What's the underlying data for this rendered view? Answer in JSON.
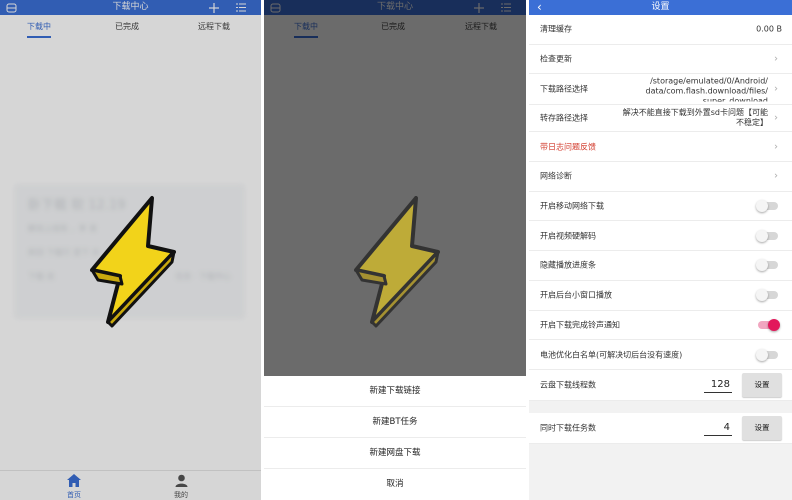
{
  "panel1": {
    "title": "下载中心",
    "tabs": [
      "下载中",
      "已完成",
      "远程下载"
    ],
    "card_title": " 卧下载 软 12.19",
    "card_lines": [
      "解说上线有 ，享 发",
      "新旧 下载行 里下 合"
    ],
    "card_footer_left": "下载 说",
    "card_footer_right": "任务 · 下载中心",
    "bottom_nav": [
      {
        "label": "首页",
        "icon": "home-icon"
      },
      {
        "label": "我的",
        "icon": "user-icon"
      }
    ]
  },
  "panel2": {
    "title": "下载中心",
    "tabs": [
      "下载中",
      "已完成",
      "远程下载"
    ],
    "sheet_items": [
      "新建下载链接",
      "新建BT任务",
      "新建网盘下载",
      "取消"
    ]
  },
  "panel3": {
    "title": "设置",
    "rows": [
      {
        "label": "清理缓存",
        "value": "0.00 B"
      },
      {
        "label": "检查更新"
      },
      {
        "label": "下载路径选择",
        "value_lines": [
          "/storage/emulated/0/Android/",
          "data/com.flash.download/files/",
          "super_download"
        ]
      },
      {
        "label": "转存路径选择",
        "value_lines": [
          "解决不能直接下载到外置sd卡问题【可能",
          "不稳定】"
        ]
      },
      {
        "label": "带日志问题反馈"
      },
      {
        "label": "网络诊断"
      }
    ],
    "toggles": [
      {
        "label": "开启移动网络下载",
        "on": false
      },
      {
        "label": "开启视频硬解码",
        "on": false
      },
      {
        "label": "隐藏播放进度条",
        "on": false
      },
      {
        "label": "开启后台小窗口播放",
        "on": false
      },
      {
        "label": "开启下载完成铃声通知",
        "on": true
      },
      {
        "label": "电池优化白名单(可解决切后台没有速度)",
        "on": false
      }
    ],
    "number_rows": [
      {
        "label": "云盘下载线程数",
        "value": "128",
        "button": "设置"
      },
      {
        "label": "同时下载任务数",
        "value": "4",
        "button": "设置"
      }
    ]
  },
  "colors": {
    "accent": "#3b6fd6",
    "feedback_red": "#d23a2b",
    "toggle_on": "#e2185b",
    "logo_yellow": "#f2d31a"
  }
}
